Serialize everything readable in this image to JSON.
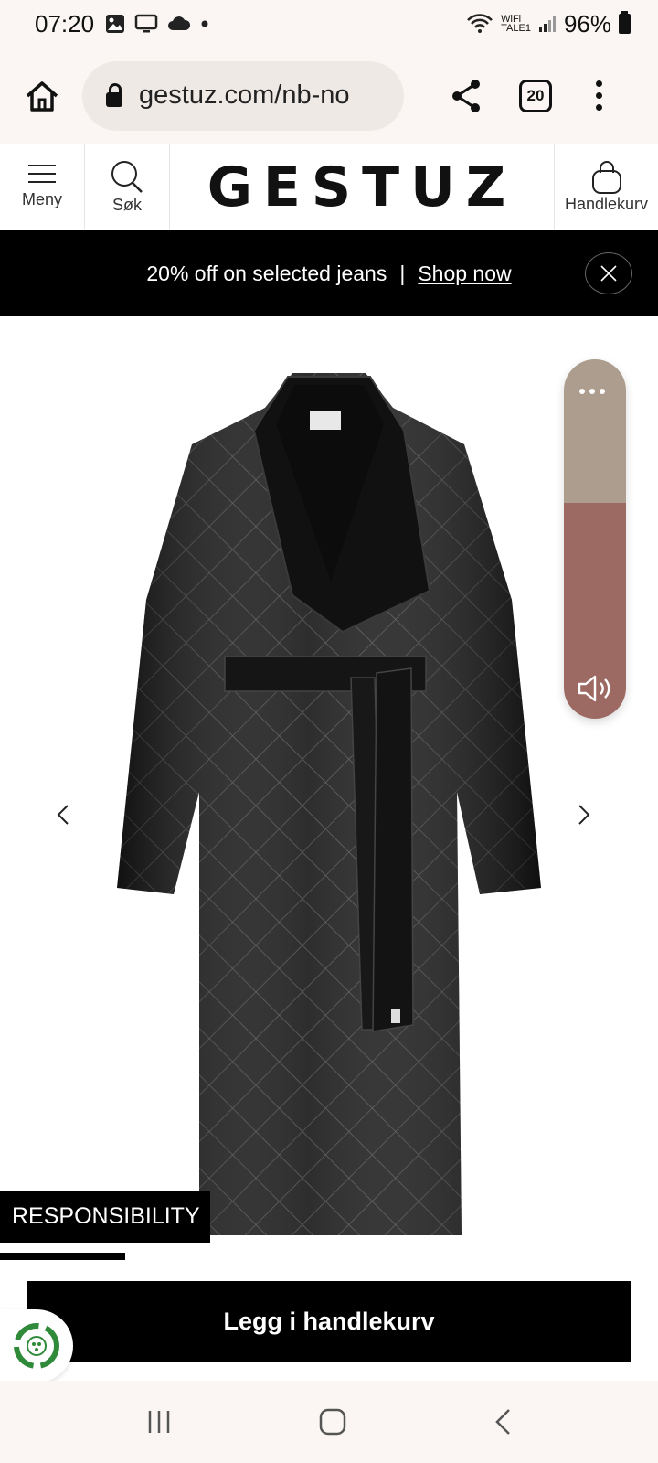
{
  "status_bar": {
    "time": "07:20",
    "wifi_label_top": "WiFi",
    "wifi_label_bottom": "TALE1",
    "battery": "96%"
  },
  "browser": {
    "url": "gestuz.com/nb-no",
    "tab_count": "20"
  },
  "header": {
    "menu_label": "Meny",
    "search_label": "Søk",
    "logo": "GESTUZ",
    "cart_label": "Handlekurv"
  },
  "promo": {
    "text": "20% off on selected jeans",
    "separator": "|",
    "link": "Shop now"
  },
  "product": {
    "responsibility_tab": "RESPONSIBILITY",
    "add_to_cart": "Legg i handlekurv",
    "image_progress": 0.19
  },
  "colors": {
    "widget_top": "#ad9d8e",
    "widget_bottom": "#9c6a62",
    "eco_green": "#2f8a3a"
  }
}
